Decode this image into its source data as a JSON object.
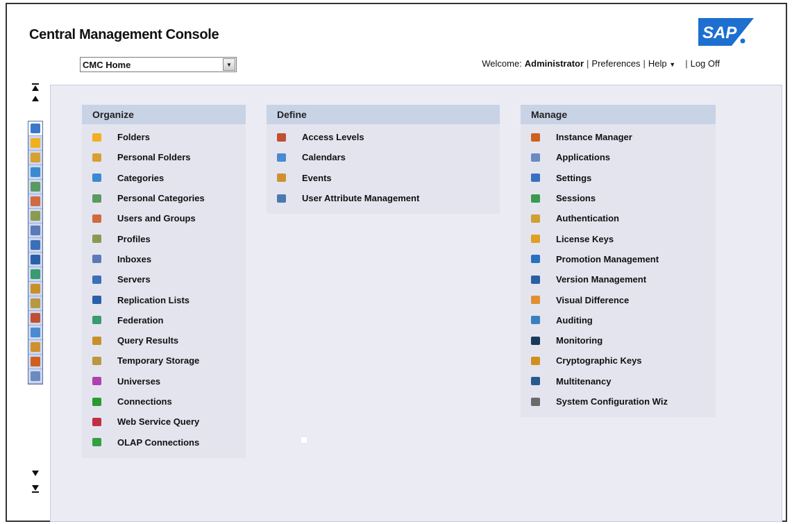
{
  "app": {
    "title": "Central Management Console",
    "logo_text": "SAP"
  },
  "nav_select": {
    "value": "CMC Home"
  },
  "topbar": {
    "welcome_label": "Welcome:",
    "user": "Administrator",
    "preferences": "Preferences",
    "help": "Help",
    "log_off": "Log Off"
  },
  "sidebar": {
    "icons": [
      {
        "name": "cmc-home-icon",
        "color": "#3a78c8",
        "active": true
      },
      {
        "name": "folders-icon",
        "color": "#f0b020"
      },
      {
        "name": "personal-folders-icon",
        "color": "#d8a030"
      },
      {
        "name": "categories-icon",
        "color": "#3a8ad0"
      },
      {
        "name": "personal-categories-icon",
        "color": "#5a9a60"
      },
      {
        "name": "users-and-groups-icon",
        "color": "#d06a40"
      },
      {
        "name": "profiles-icon",
        "color": "#8a9a50"
      },
      {
        "name": "inboxes-icon",
        "color": "#5a7ab8"
      },
      {
        "name": "servers-icon",
        "color": "#3a70b8"
      },
      {
        "name": "replication-lists-icon",
        "color": "#2a60a8"
      },
      {
        "name": "federation-icon",
        "color": "#3a9a70"
      },
      {
        "name": "query-results-icon",
        "color": "#c89028"
      },
      {
        "name": "temporary-storage-icon",
        "color": "#b89840"
      },
      {
        "name": "access-levels-icon",
        "color": "#c05030"
      },
      {
        "name": "calendars-icon",
        "color": "#4a8ad0"
      },
      {
        "name": "events-icon",
        "color": "#d09030"
      },
      {
        "name": "instance-manager-icon",
        "color": "#d06020"
      },
      {
        "name": "applications-icon",
        "color": "#6a8ac0"
      }
    ]
  },
  "columns": [
    {
      "header": "Organize",
      "items": [
        {
          "label": "Folders",
          "icon": "folder-icon",
          "color": "#f0b020"
        },
        {
          "label": "Personal Folders",
          "icon": "personal-folder-icon",
          "color": "#d8a030"
        },
        {
          "label": "Categories",
          "icon": "categories-icon",
          "color": "#3a8ad0"
        },
        {
          "label": "Personal Categories",
          "icon": "personal-categories-icon",
          "color": "#5a9a60"
        },
        {
          "label": "Users and Groups",
          "icon": "users-groups-icon",
          "color": "#d06a40"
        },
        {
          "label": "Profiles",
          "icon": "profiles-icon",
          "color": "#8a9a50"
        },
        {
          "label": "Inboxes",
          "icon": "inbox-icon",
          "color": "#5a7ab8"
        },
        {
          "label": "Servers",
          "icon": "servers-icon",
          "color": "#3a70b8"
        },
        {
          "label": "Replication Lists",
          "icon": "replication-icon",
          "color": "#2a60a8"
        },
        {
          "label": "Federation",
          "icon": "federation-icon",
          "color": "#3a9a70"
        },
        {
          "label": "Query Results",
          "icon": "query-results-icon",
          "color": "#c89028"
        },
        {
          "label": "Temporary Storage",
          "icon": "temporary-storage-icon",
          "color": "#b89840"
        },
        {
          "label": "Universes",
          "icon": "universes-icon",
          "color": "#b040b0"
        },
        {
          "label": "Connections",
          "icon": "connections-icon",
          "color": "#2a9a30"
        },
        {
          "label": "Web Service Query",
          "icon": "web-service-query-icon",
          "color": "#c03040"
        },
        {
          "label": "OLAP Connections",
          "icon": "olap-connections-icon",
          "color": "#30a040"
        }
      ]
    },
    {
      "header": "Define",
      "items": [
        {
          "label": "Access Levels",
          "icon": "access-levels-icon",
          "color": "#c05030"
        },
        {
          "label": "Calendars",
          "icon": "calendars-icon",
          "color": "#4a8ad0"
        },
        {
          "label": "Events",
          "icon": "events-icon",
          "color": "#d09030"
        },
        {
          "label": "User Attribute Management",
          "icon": "user-attribute-icon",
          "color": "#4a7ab0"
        }
      ]
    },
    {
      "header": "Manage",
      "items": [
        {
          "label": "Instance Manager",
          "icon": "instance-manager-icon",
          "color": "#d06020"
        },
        {
          "label": "Applications",
          "icon": "applications-icon",
          "color": "#6a8ac0"
        },
        {
          "label": "Settings",
          "icon": "settings-icon",
          "color": "#3a70c0"
        },
        {
          "label": "Sessions",
          "icon": "sessions-icon",
          "color": "#3a9a50"
        },
        {
          "label": "Authentication",
          "icon": "lock-icon",
          "color": "#d0a030"
        },
        {
          "label": "License Keys",
          "icon": "key-icon",
          "color": "#e0a020"
        },
        {
          "label": "Promotion Management",
          "icon": "promotion-icon",
          "color": "#2a70c0"
        },
        {
          "label": "Version Management",
          "icon": "version-icon",
          "color": "#2a60a0"
        },
        {
          "label": "Visual Difference",
          "icon": "visual-difference-icon",
          "color": "#e09030"
        },
        {
          "label": "Auditing",
          "icon": "auditing-icon",
          "color": "#3a80c0"
        },
        {
          "label": "Monitoring",
          "icon": "monitoring-icon",
          "color": "#1a3a5a"
        },
        {
          "label": "Cryptographic Keys",
          "icon": "cryptographic-keys-icon",
          "color": "#d09020"
        },
        {
          "label": "Multitenancy",
          "icon": "multitenancy-icon",
          "color": "#2a5a8a"
        },
        {
          "label": "System Configuration Wiz",
          "icon": "system-config-icon",
          "color": "#6a6a6a"
        }
      ]
    }
  ]
}
